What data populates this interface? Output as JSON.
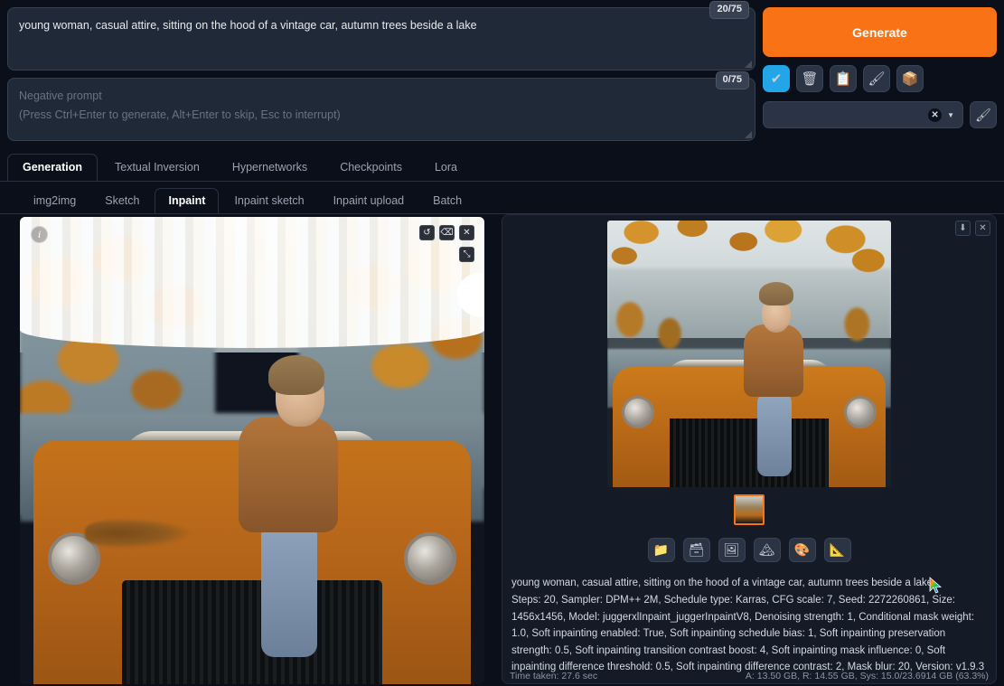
{
  "prompt": {
    "value": "young woman, casual attire, sitting on the hood of a vintage car, autumn trees beside a lake",
    "counter": "20/75"
  },
  "negative_prompt": {
    "placeholder_line1": "Negative prompt",
    "placeholder_line2": "(Press Ctrl+Enter to generate, Alt+Enter to skip, Esc to interrupt)",
    "value": "",
    "counter": "0/75"
  },
  "generate": {
    "label": "Generate"
  },
  "quick_icons": [
    {
      "name": "checkbox-icon",
      "glyph": "✔"
    },
    {
      "name": "trash-icon",
      "glyph": "🗑"
    },
    {
      "name": "clipboard-icon",
      "glyph": "📋"
    },
    {
      "name": "paintbrush-icon",
      "glyph": "🖌"
    },
    {
      "name": "box-icon",
      "glyph": "📦"
    }
  ],
  "styles": {
    "value": "",
    "clear_glyph": "✕",
    "caret_glyph": "▼",
    "edit_glyph": "🖌"
  },
  "tabs": [
    {
      "label": "Generation",
      "active": true
    },
    {
      "label": "Textual Inversion",
      "active": false
    },
    {
      "label": "Hypernetworks",
      "active": false
    },
    {
      "label": "Checkpoints",
      "active": false
    },
    {
      "label": "Lora",
      "active": false
    }
  ],
  "subtabs": [
    {
      "label": "img2img",
      "active": false
    },
    {
      "label": "Sketch",
      "active": false
    },
    {
      "label": "Inpaint",
      "active": true
    },
    {
      "label": "Inpaint sketch",
      "active": false
    },
    {
      "label": "Inpaint upload",
      "active": false
    },
    {
      "label": "Batch",
      "active": false
    }
  ],
  "canvas": {
    "info_glyph": "i",
    "tools": [
      {
        "name": "undo-icon",
        "glyph": "↺"
      },
      {
        "name": "eraser-icon",
        "glyph": "⌫"
      },
      {
        "name": "close-icon",
        "glyph": "✕"
      }
    ],
    "expand_glyph": "⤡"
  },
  "result": {
    "top_buttons": [
      {
        "name": "download-icon",
        "glyph": "⬇"
      },
      {
        "name": "close-icon",
        "glyph": "✕"
      }
    ],
    "tools": [
      {
        "name": "folder-icon",
        "glyph": "📁"
      },
      {
        "name": "save-zip-icon",
        "glyph": "🗃"
      },
      {
        "name": "send-img2img-icon",
        "glyph": "🖼"
      },
      {
        "name": "send-inpaint-icon",
        "glyph": "🏔"
      },
      {
        "name": "send-extras-icon",
        "glyph": "🎨"
      },
      {
        "name": "ruler-icon",
        "glyph": "📐"
      }
    ]
  },
  "params": {
    "line1": "young woman, casual attire, sitting on the hood of a vintage car, autumn trees beside a lake",
    "line2": "Steps: 20, Sampler: DPM++ 2M, Schedule type: Karras, CFG scale: 7, Seed: 2272260861, Size: 1456x1456, Model: juggerxlInpaint_juggerInpaintV8, Denoising strength: 1, Conditional mask weight: 1.0, Soft inpainting enabled: True, Soft inpainting schedule bias: 1, Soft inpainting preservation strength: 0.5, Soft inpainting transition contrast boost: 4, Soft inpainting mask influence: 0, Soft inpainting difference threshold: 0.5, Soft inpainting difference contrast: 2, Mask blur: 20, Version: v1.9.3"
  },
  "status": {
    "time_taken": "Time taken: 27.6 sec",
    "memory": "A: 13.50 GB, R: 14.55 GB, Sys: 15.0/23.6914 GB (63.3%)"
  },
  "colors": {
    "accent_orange": "#f97316",
    "panel": "#1f2937",
    "background": "#0b0f19",
    "accent_blue": "#22a6e8"
  }
}
